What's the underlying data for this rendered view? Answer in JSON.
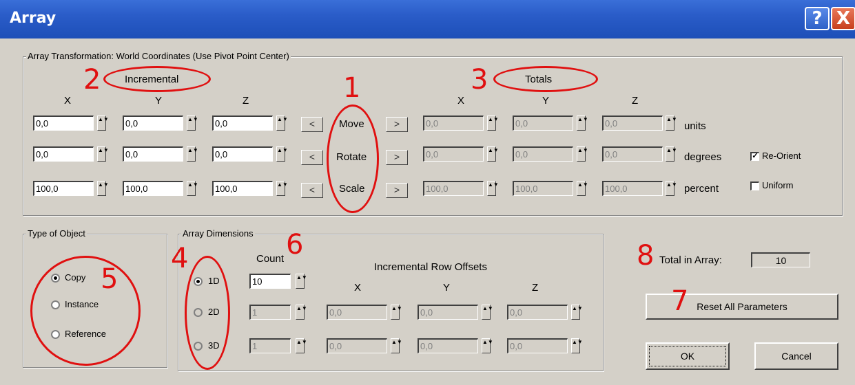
{
  "window": {
    "title": "Array",
    "help_icon": "?",
    "close_icon": "X"
  },
  "transform_group": {
    "label": "Array Transformation: World Coordinates (Use Pivot Point Center)",
    "incremental_label": "Incremental",
    "totals_label": "Totals",
    "axis_x": "X",
    "axis_y": "Y",
    "axis_z": "Z",
    "rows": [
      {
        "name": "Move",
        "unit": "units",
        "inc": [
          "0,0",
          "0,0",
          "0,0"
        ],
        "tot": [
          "0,0",
          "0,0",
          "0,0"
        ]
      },
      {
        "name": "Rotate",
        "unit": "degrees",
        "inc": [
          "0,0",
          "0,0",
          "0,0"
        ],
        "tot": [
          "0,0",
          "0,0",
          "0,0"
        ]
      },
      {
        "name": "Scale",
        "unit": "percent",
        "inc": [
          "100,0",
          "100,0",
          "100,0"
        ],
        "tot": [
          "100,0",
          "100,0",
          "100,0"
        ]
      }
    ],
    "left_arrow": "<",
    "right_arrow": ">",
    "reorient_label": "Re-Orient",
    "reorient_checked": true,
    "uniform_label": "Uniform",
    "uniform_checked": false
  },
  "type_of_object": {
    "label": "Type of Object",
    "options": [
      "Copy",
      "Instance",
      "Reference"
    ],
    "selected": "Copy"
  },
  "array_dimensions": {
    "label": "Array Dimensions",
    "count_label": "Count",
    "offsets_label": "Incremental Row Offsets",
    "axis_x": "X",
    "axis_y": "Y",
    "axis_z": "Z",
    "dims": [
      {
        "label": "1D",
        "count": "10",
        "x": "",
        "y": "",
        "z": ""
      },
      {
        "label": "2D",
        "count": "1",
        "x": "0,0",
        "y": "0,0",
        "z": "0,0"
      },
      {
        "label": "3D",
        "count": "1",
        "x": "0,0",
        "y": "0,0",
        "z": "0,0"
      }
    ],
    "selected": "1D"
  },
  "total_in_array": {
    "label": "Total in Array:",
    "value": "10"
  },
  "buttons": {
    "reset": "Reset All Parameters",
    "ok": "OK",
    "cancel": "Cancel"
  },
  "annotations": [
    "1",
    "2",
    "3",
    "4",
    "5",
    "6",
    "7",
    "8"
  ],
  "spinner_glyph": "▲▼",
  "accent_colors": {
    "annotation": "#e01010",
    "titlebar": "#2a5cc8",
    "dialog_bg": "#d4d0c8"
  }
}
